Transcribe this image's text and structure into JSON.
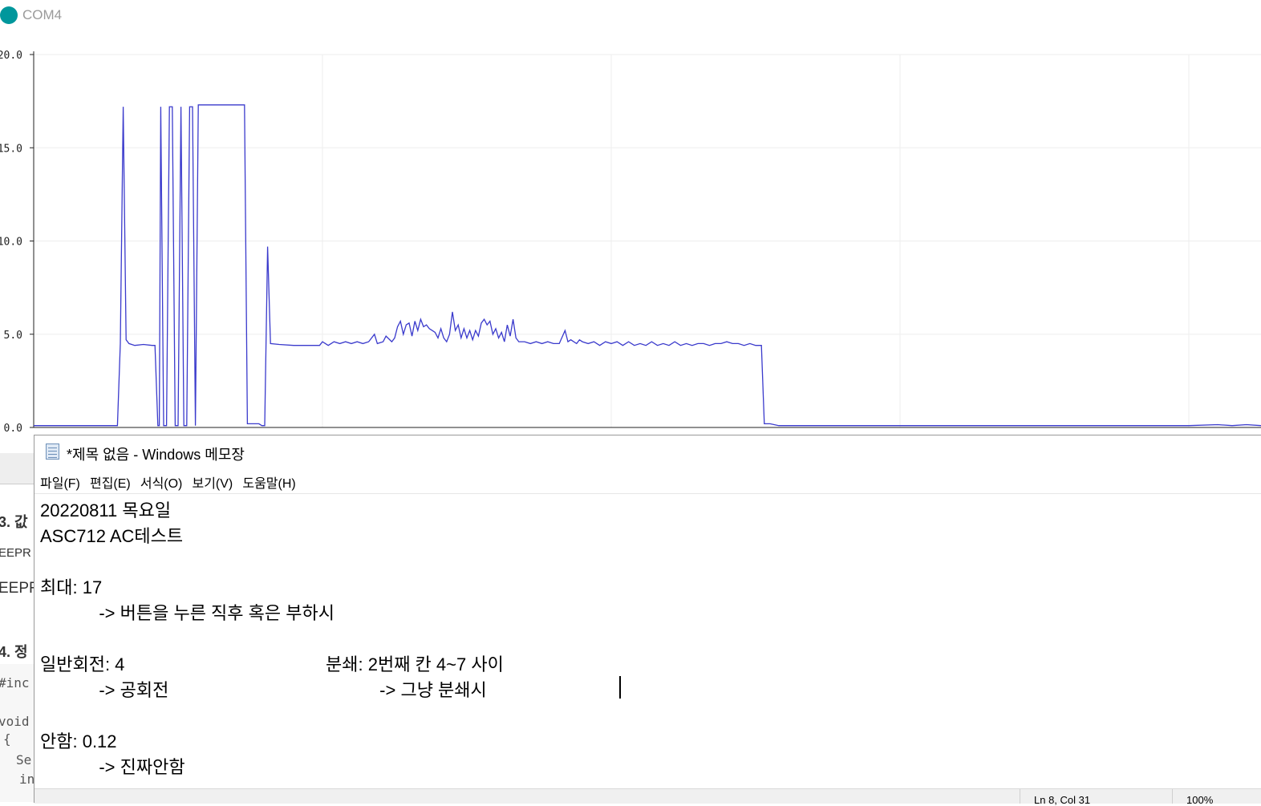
{
  "plotter": {
    "title": "COM4",
    "y_tick_labels": [
      "20.0",
      "15.0",
      "10.0",
      "5.0",
      "0.0"
    ]
  },
  "chart_data": {
    "type": "line",
    "title": "",
    "xlabel": "",
    "ylabel": "",
    "xlim": [
      0,
      425
    ],
    "ylim": [
      0,
      20
    ],
    "grid": true,
    "series": [
      {
        "color": "#3a3acc",
        "points": [
          [
            0,
            0.1
          ],
          [
            28,
            0.1
          ],
          [
            29,
            0.1
          ],
          [
            30,
            4.5
          ],
          [
            31,
            17.2
          ],
          [
            32,
            4.7
          ],
          [
            33,
            4.5
          ],
          [
            35,
            4.4
          ],
          [
            38,
            4.45
          ],
          [
            41,
            4.4
          ],
          [
            42,
            4.4
          ],
          [
            43,
            0.1
          ],
          [
            43.5,
            0.1
          ],
          [
            44,
            17.2
          ],
          [
            45,
            0.1
          ],
          [
            46,
            0.1
          ],
          [
            47,
            17.2
          ],
          [
            48,
            17.2
          ],
          [
            49,
            0.1
          ],
          [
            50,
            0.1
          ],
          [
            51,
            17.2
          ],
          [
            52,
            0.1
          ],
          [
            53,
            0.1
          ],
          [
            54,
            17.2
          ],
          [
            55,
            17.2
          ],
          [
            56,
            0.1
          ],
          [
            57,
            17.3
          ],
          [
            58,
            17.3
          ],
          [
            60,
            17.3
          ],
          [
            65,
            17.3
          ],
          [
            70,
            17.3
          ],
          [
            73,
            17.3
          ],
          [
            74,
            0.2
          ],
          [
            76,
            0.2
          ],
          [
            78,
            0.2
          ],
          [
            79,
            0.1
          ],
          [
            80,
            0.1
          ],
          [
            81,
            9.7
          ],
          [
            82,
            4.5
          ],
          [
            85,
            4.45
          ],
          [
            90,
            4.4
          ],
          [
            95,
            4.4
          ],
          [
            99,
            4.4
          ],
          [
            100,
            4.6
          ],
          [
            102,
            4.4
          ],
          [
            104,
            4.6
          ],
          [
            106,
            4.5
          ],
          [
            108,
            4.6
          ],
          [
            110,
            4.5
          ],
          [
            112,
            4.6
          ],
          [
            114,
            4.5
          ],
          [
            116,
            4.6
          ],
          [
            118,
            5.0
          ],
          [
            119,
            4.5
          ],
          [
            121,
            4.6
          ],
          [
            122,
            4.9
          ],
          [
            124,
            4.6
          ],
          [
            125,
            4.8
          ],
          [
            126,
            5.4
          ],
          [
            127,
            5.7
          ],
          [
            128,
            5.0
          ],
          [
            129,
            5.5
          ],
          [
            130,
            5.6
          ],
          [
            131,
            4.9
          ],
          [
            132,
            5.7
          ],
          [
            133,
            5.2
          ],
          [
            134,
            5.8
          ],
          [
            135,
            5.4
          ],
          [
            136,
            5.5
          ],
          [
            137,
            5.3
          ],
          [
            138,
            5.2
          ],
          [
            139,
            5.1
          ],
          [
            140,
            4.8
          ],
          [
            141,
            5.3
          ],
          [
            142,
            4.8
          ],
          [
            143,
            4.6
          ],
          [
            144,
            5.0
          ],
          [
            145,
            6.2
          ],
          [
            146,
            5.2
          ],
          [
            147,
            5.5
          ],
          [
            148,
            4.8
          ],
          [
            149,
            5.3
          ],
          [
            150,
            4.8
          ],
          [
            151,
            5.2
          ],
          [
            152,
            4.7
          ],
          [
            153,
            5.2
          ],
          [
            154,
            4.9
          ],
          [
            155,
            5.6
          ],
          [
            156,
            5.8
          ],
          [
            157,
            5.5
          ],
          [
            158,
            5.7
          ],
          [
            159,
            5.0
          ],
          [
            160,
            5.3
          ],
          [
            161,
            4.8
          ],
          [
            162,
            5.1
          ],
          [
            163,
            4.6
          ],
          [
            164,
            5.5
          ],
          [
            165,
            4.9
          ],
          [
            166,
            5.8
          ],
          [
            167,
            4.8
          ],
          [
            168,
            4.6
          ],
          [
            170,
            4.6
          ],
          [
            172,
            4.5
          ],
          [
            174,
            4.6
          ],
          [
            176,
            4.5
          ],
          [
            178,
            4.6
          ],
          [
            180,
            4.5
          ],
          [
            182,
            4.5
          ],
          [
            184,
            5.2
          ],
          [
            185,
            4.6
          ],
          [
            186,
            4.7
          ],
          [
            188,
            4.5
          ],
          [
            189,
            4.7
          ],
          [
            190,
            4.6
          ],
          [
            192,
            4.5
          ],
          [
            194,
            4.6
          ],
          [
            196,
            4.4
          ],
          [
            198,
            4.6
          ],
          [
            200,
            4.5
          ],
          [
            202,
            4.6
          ],
          [
            204,
            4.4
          ],
          [
            206,
            4.6
          ],
          [
            208,
            4.4
          ],
          [
            210,
            4.5
          ],
          [
            212,
            4.4
          ],
          [
            214,
            4.6
          ],
          [
            216,
            4.4
          ],
          [
            218,
            4.5
          ],
          [
            220,
            4.4
          ],
          [
            222,
            4.6
          ],
          [
            224,
            4.4
          ],
          [
            226,
            4.5
          ],
          [
            228,
            4.4
          ],
          [
            230,
            4.5
          ],
          [
            232,
            4.5
          ],
          [
            234,
            4.4
          ],
          [
            236,
            4.5
          ],
          [
            238,
            4.5
          ],
          [
            240,
            4.6
          ],
          [
            242,
            4.5
          ],
          [
            244,
            4.5
          ],
          [
            246,
            4.4
          ],
          [
            248,
            4.5
          ],
          [
            250,
            4.4
          ],
          [
            252,
            4.4
          ],
          [
            253,
            0.2
          ],
          [
            255,
            0.2
          ],
          [
            258,
            0.1
          ],
          [
            262,
            0.1
          ],
          [
            270,
            0.1
          ],
          [
            280,
            0.1
          ],
          [
            300,
            0.1
          ],
          [
            320,
            0.1
          ],
          [
            340,
            0.1
          ],
          [
            360,
            0.1
          ],
          [
            380,
            0.1
          ],
          [
            400,
            0.1
          ],
          [
            410,
            0.15
          ],
          [
            415,
            0.1
          ],
          [
            420,
            0.15
          ],
          [
            425,
            0.1
          ]
        ]
      }
    ]
  },
  "notepad": {
    "title": "*제목 없음 - Windows 메모장",
    "menu": [
      "파일(F)",
      "편집(E)",
      "서식(O)",
      "보기(V)",
      "도움말(H)"
    ],
    "lines": [
      "20220811 목요일",
      "ASC712 AC테스트",
      "",
      "최대: 17",
      "            -> 버튼을 누른 직후 혹은 부하시",
      "",
      "일반회전: 4                                         분쇄: 2번째 칸 4~7 사이",
      "            -> 공회전                                           -> 그냥 분쇄시",
      "",
      "안함: 0.12",
      "            -> 진짜안함"
    ],
    "status": {
      "position": "Ln 8, Col 31",
      "zoom": "100%"
    }
  },
  "background_doc": {
    "snippets": [
      "3. 값",
      "EEPR",
      "EEPR",
      "4. 정",
      "#inc",
      "void",
      "{",
      "Se",
      "in"
    ]
  }
}
